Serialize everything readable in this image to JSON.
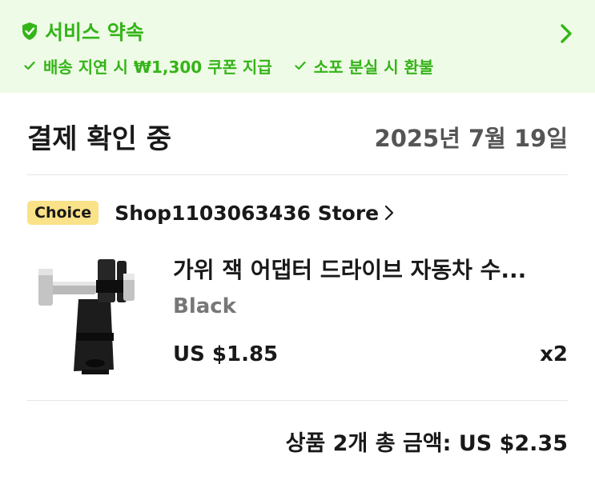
{
  "service_banner": {
    "title": "서비스 약속",
    "icon": "shield-check-icon",
    "guarantees": [
      {
        "label": "배송 지연 시 ₩1,300 쿠폰 지급",
        "icon": "checkmark-icon"
      },
      {
        "label": "소포 분실 시 환불",
        "icon": "checkmark-icon"
      }
    ],
    "accent_color": "#35b419"
  },
  "order": {
    "status": "결제 확인 중",
    "date": "2025년 7월 19일",
    "store": {
      "badge": "Choice",
      "name": "Shop1103063436 Store"
    },
    "item": {
      "title": "가위 잭 어댑터 드라이브 자동차 수...",
      "variant": "Black",
      "price": "US $1.85",
      "quantity": "x2"
    },
    "total": "상품 2개 총 금액: US $2.35"
  }
}
